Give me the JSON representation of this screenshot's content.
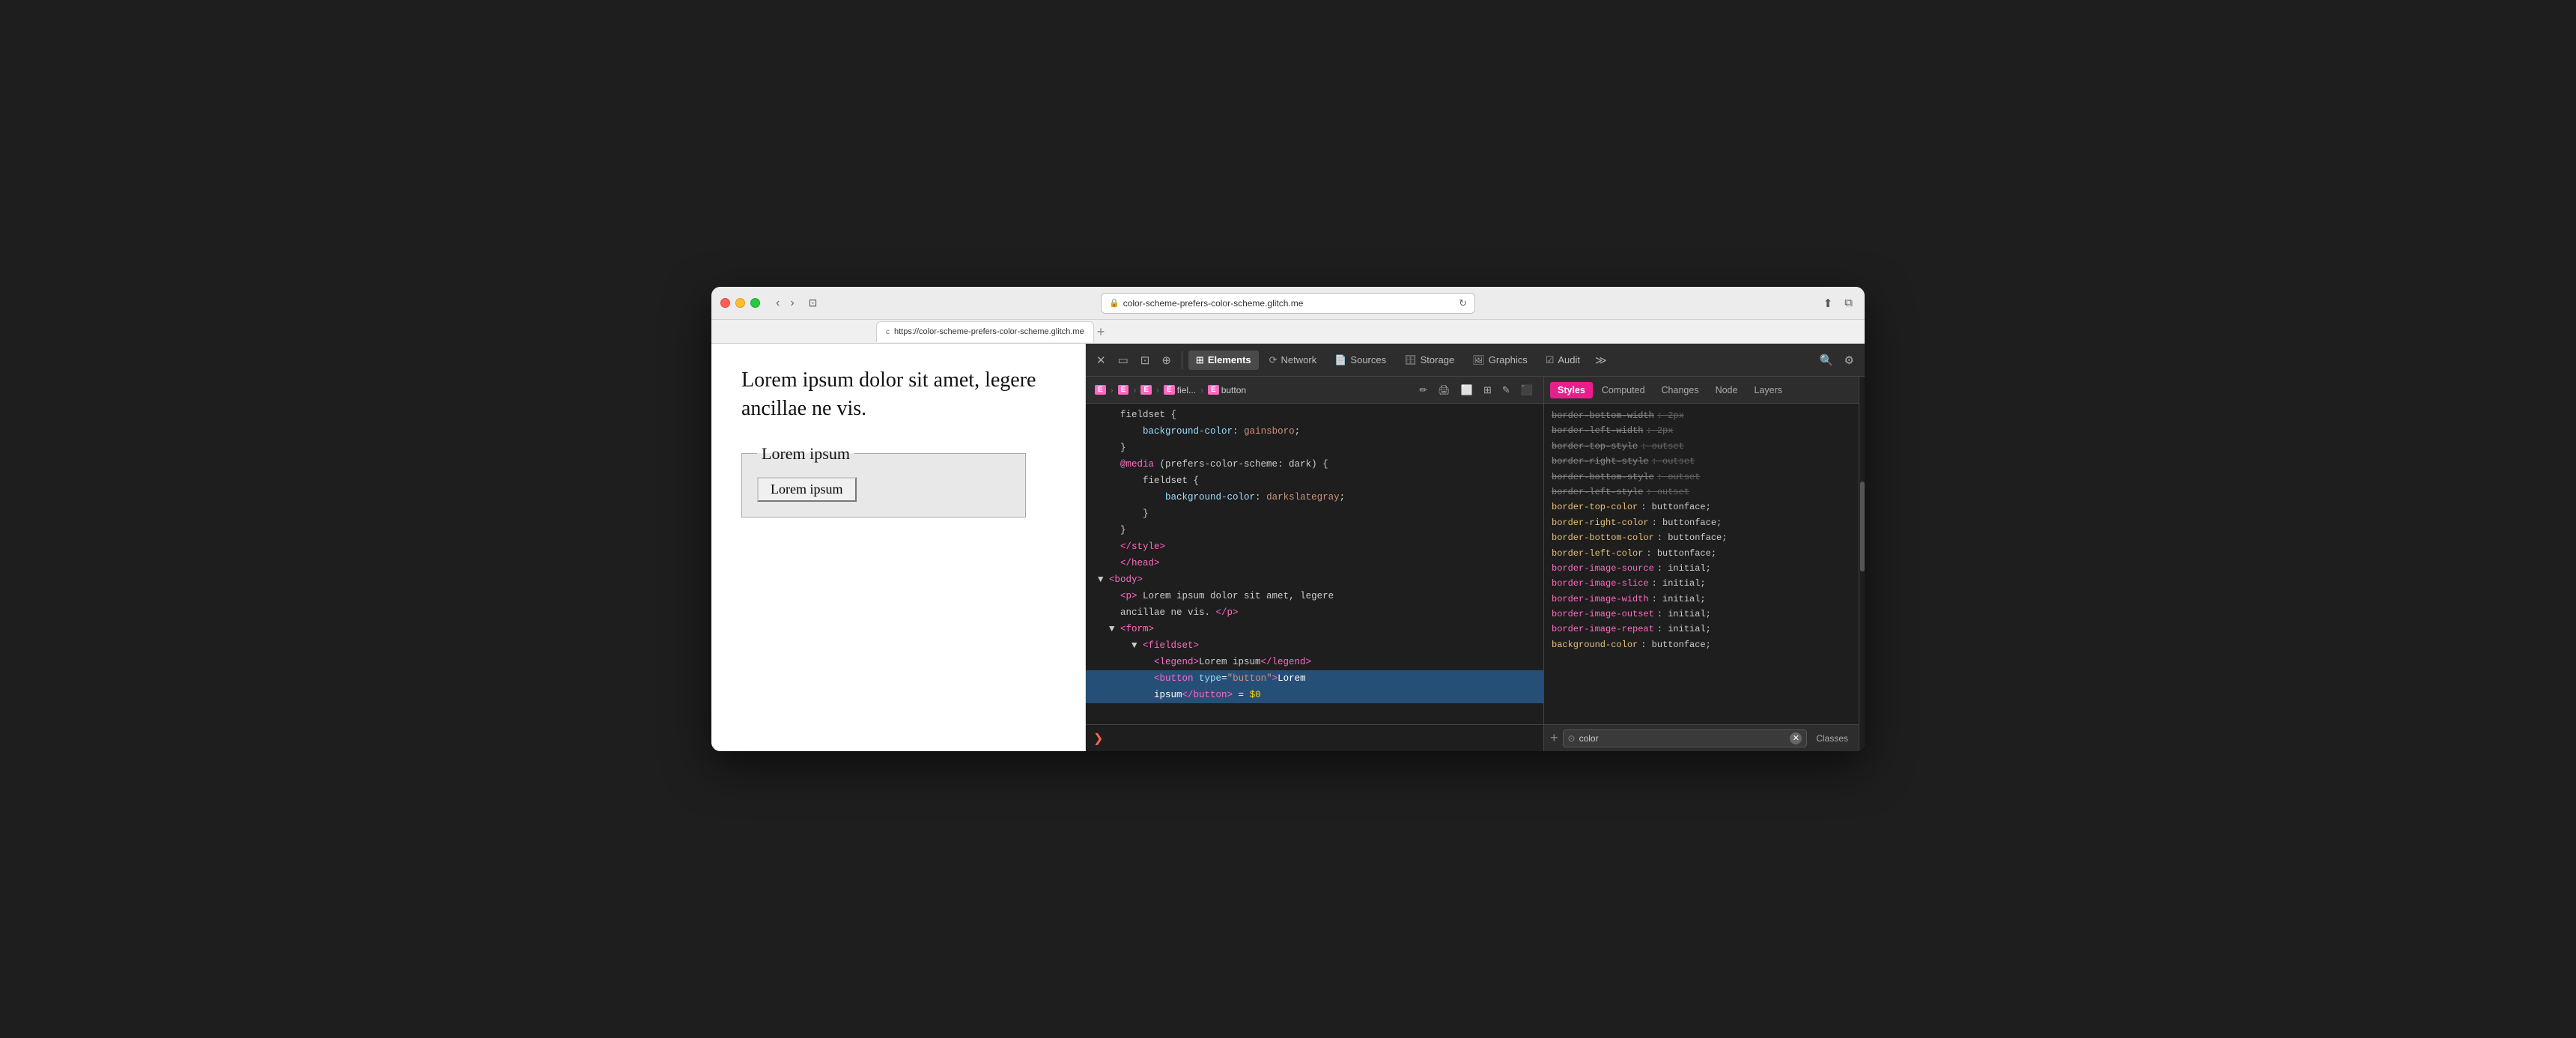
{
  "browser": {
    "url": "color-scheme-prefers-color-scheme.glitch.me",
    "full_url": "https://color-scheme-prefers-color-scheme.glitch.me",
    "tab_favicon": "c",
    "window_add_btn": "+"
  },
  "nav": {
    "back": "‹",
    "forward": "›",
    "sidebar_icon": "⊡"
  },
  "page": {
    "paragraph": "Lorem ipsum dolor sit amet,\nlegere ancillae ne vis.",
    "legend_text": "Lorem ipsum",
    "button_text": "Lorem ipsum"
  },
  "devtools": {
    "tabs": [
      {
        "id": "elements",
        "label": "Elements",
        "icon": "⊞",
        "active": true
      },
      {
        "id": "network",
        "label": "Network",
        "icon": "⟳"
      },
      {
        "id": "sources",
        "label": "Sources",
        "icon": "📄"
      },
      {
        "id": "storage",
        "label": "Storage",
        "icon": "🗄"
      },
      {
        "id": "graphics",
        "label": "Graphics",
        "icon": "🖼"
      },
      {
        "id": "audit",
        "label": "Audit",
        "icon": "☑"
      }
    ],
    "more_btn": "≫",
    "search_icon": "🔍",
    "settings_icon": "⚙"
  },
  "breadcrumb": {
    "items": [
      {
        "tag": "E",
        "label": ""
      },
      {
        "tag": "E",
        "label": ""
      },
      {
        "tag": "E",
        "label": ""
      },
      {
        "tag": "E",
        "label": "fiel..."
      },
      {
        "tag": "E",
        "label": "button"
      }
    ],
    "icons": [
      "pencil",
      "inspect",
      "square",
      "grid",
      "edit",
      "close-red"
    ]
  },
  "elements_tree": [
    {
      "content": "    fieldset {",
      "selected": false,
      "indent": 4
    },
    {
      "content": "        background-color: gainsboro;",
      "selected": false,
      "indent": 8
    },
    {
      "content": "    }",
      "selected": false,
      "indent": 4
    },
    {
      "content": "    @media (prefers-color-scheme: dark) {",
      "selected": false,
      "indent": 4
    },
    {
      "content": "        fieldset {",
      "selected": false,
      "indent": 8
    },
    {
      "content": "            background-color: darkslategray;",
      "selected": false,
      "indent": 12
    },
    {
      "content": "        }",
      "selected": false,
      "indent": 8
    },
    {
      "content": "    }",
      "selected": false,
      "indent": 4
    },
    {
      "content": "    </style>",
      "selected": false,
      "tag": true
    },
    {
      "content": "    </head>",
      "selected": false,
      "tag": true
    },
    {
      "content": "▼ <body>",
      "selected": false,
      "tag": true
    },
    {
      "content": "    <p> Lorem ipsum dolor sit amet, legere",
      "selected": false,
      "tag": true
    },
    {
      "content": "    ancillae ne vis. </p>",
      "selected": false,
      "tag": true
    },
    {
      "content": "  ▼ <form>",
      "selected": false,
      "tag": true
    },
    {
      "content": "      ▼ <fieldset>",
      "selected": false,
      "tag": true
    },
    {
      "content": "          <legend>Lorem ipsum</legend>",
      "selected": false,
      "tag": true
    },
    {
      "content": "          <button type=\"button\">Lorem",
      "selected": true,
      "tag": true
    },
    {
      "content": "          ipsum</button> = $0",
      "selected": true,
      "tag": true,
      "dollar": true
    }
  ],
  "styles_tabs": [
    {
      "id": "styles",
      "label": "Styles",
      "active": true
    },
    {
      "id": "computed",
      "label": "Computed",
      "active": false
    },
    {
      "id": "changes",
      "label": "Changes",
      "active": false
    },
    {
      "id": "node",
      "label": "Node",
      "active": false
    },
    {
      "id": "layers",
      "label": "Layers",
      "active": false
    }
  ],
  "style_properties": [
    {
      "name": "border-bottom-width",
      "value": "2px",
      "struck": true
    },
    {
      "name": "border-left-width",
      "value": "2px",
      "struck": true
    },
    {
      "name": "border-top-style",
      "value": "outset",
      "struck": true
    },
    {
      "name": "border-right-style",
      "value": "outset",
      "struck": true
    },
    {
      "name": "border-bottom-style",
      "value": "outset",
      "struck": true
    },
    {
      "name": "border-left-style",
      "value": "outset",
      "struck": true
    },
    {
      "name": "border-top-color",
      "value": "buttonface",
      "struck": false,
      "highlight": true
    },
    {
      "name": "border-right-color",
      "value": "buttonface",
      "struck": false,
      "highlight": true
    },
    {
      "name": "border-bottom-color",
      "value": "buttonface",
      "struck": false,
      "highlight": true
    },
    {
      "name": "border-left-color",
      "value": "buttonface",
      "struck": false,
      "highlight": true
    },
    {
      "name": "border-image-source",
      "value": "initial",
      "struck": false
    },
    {
      "name": "border-image-slice",
      "value": "initial",
      "struck": false
    },
    {
      "name": "border-image-width",
      "value": "initial",
      "struck": false
    },
    {
      "name": "border-image-outset",
      "value": "initial",
      "struck": false
    },
    {
      "name": "border-image-repeat",
      "value": "initial",
      "struck": false
    },
    {
      "name": "background-color",
      "value": "buttonface",
      "struck": false,
      "highlight": true,
      "bg": true
    }
  ],
  "filter": {
    "placeholder": "color",
    "value": "color",
    "classes_label": "Classes"
  },
  "console": {
    "arrow": "❯"
  }
}
